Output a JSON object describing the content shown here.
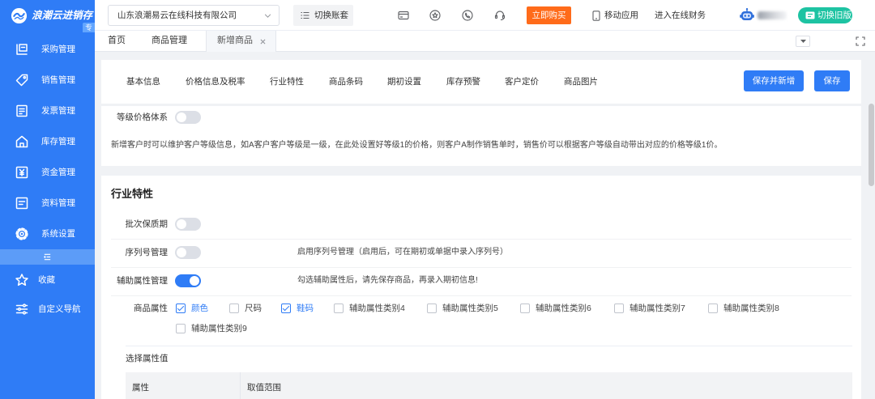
{
  "colors": {
    "primary": "#2f7cf6",
    "buy": "#ff6b1a",
    "switch_old": "#1dc3a2",
    "collapse": "#5c9cf8",
    "checked_text": "#2f7cf6"
  },
  "sidebar": {
    "logo_text": "浪潮云进销存",
    "badge": "专",
    "items": [
      {
        "label": "采购管理",
        "icon": "purchase-icon"
      },
      {
        "label": "销售管理",
        "icon": "sales-icon"
      },
      {
        "label": "发票管理",
        "icon": "invoice-icon"
      },
      {
        "label": "库存管理",
        "icon": "inventory-icon"
      },
      {
        "label": "资金管理",
        "icon": "fund-icon"
      },
      {
        "label": "资料管理",
        "icon": "data-icon"
      },
      {
        "label": "系统设置",
        "icon": "gear-icon"
      }
    ],
    "collapse_icon": "collapse-icon",
    "extra": [
      {
        "label": "收藏",
        "icon": "star-icon"
      },
      {
        "label": "自定义导航",
        "icon": "custom-nav-icon"
      }
    ]
  },
  "header": {
    "company_select": {
      "value": "山东浪潮易云在线科技有限公司",
      "icon": "chevron-down-icon"
    },
    "switch_account": {
      "label": "切换账套",
      "icon": "list-icon"
    },
    "tool_icons": [
      "card-icon",
      "star-circle-icon",
      "phone-icon",
      "headset-icon"
    ],
    "buy_now": "立即购买",
    "mobile_app": {
      "label": "移动应用",
      "icon": "mobile-icon"
    },
    "online_finance": "进入在线财务",
    "avatar_icon": "robot-avatar-icon",
    "switch_old": {
      "label": "切换旧版",
      "icon": "switch-icon"
    }
  },
  "tabs": [
    {
      "label": "首页",
      "active": false
    },
    {
      "label": "商品管理",
      "active": false
    },
    {
      "label": "新增商品",
      "active": true,
      "closable": true
    }
  ],
  "form": {
    "sections": [
      "基本信息",
      "价格信息及税率",
      "行业特性",
      "商品条码",
      "期初设置",
      "库存预警",
      "客户定价",
      "商品图片"
    ],
    "actions": {
      "save_and_new": "保存并新增",
      "save": "保存"
    },
    "grade_price": {
      "label": "等级价格体系",
      "enabled": false,
      "note": "新增客户时可以维护客户等级信息，如A客户客户等级是一级，在此处设置好等级1的价格，则客户A制作销售单时，销售价可以根据客户等级自动带出对应的价格等级1价。"
    },
    "industry": {
      "title": "行业特性",
      "batch_shelf_life": {
        "label": "批次保质期",
        "enabled": false
      },
      "serial_number": {
        "label": "序列号管理",
        "enabled": false,
        "note": "启用序列号管理（启用后，可在期初或单据中录入序列号）"
      },
      "aux_attributes": {
        "label": "辅助属性管理",
        "enabled": true,
        "note": "勾选辅助属性后，请先保存商品，再录入期初信息!"
      },
      "product_attributes": {
        "label": "商品属性",
        "options": [
          {
            "label": "颜色",
            "checked": true
          },
          {
            "label": "尺码",
            "checked": false
          },
          {
            "label": "鞋码",
            "checked": true
          },
          {
            "label": "辅助属性类别4",
            "checked": false
          },
          {
            "label": "辅助属性类别5",
            "checked": false
          },
          {
            "label": "辅助属性类别6",
            "checked": false
          },
          {
            "label": "辅助属性类别7",
            "checked": false
          },
          {
            "label": "辅助属性类别8",
            "checked": false
          },
          {
            "label": "辅助属性类别9",
            "checked": false
          }
        ]
      },
      "select_values": {
        "label": "选择属性值",
        "table_columns": [
          "属性",
          "取值范围"
        ]
      }
    }
  }
}
